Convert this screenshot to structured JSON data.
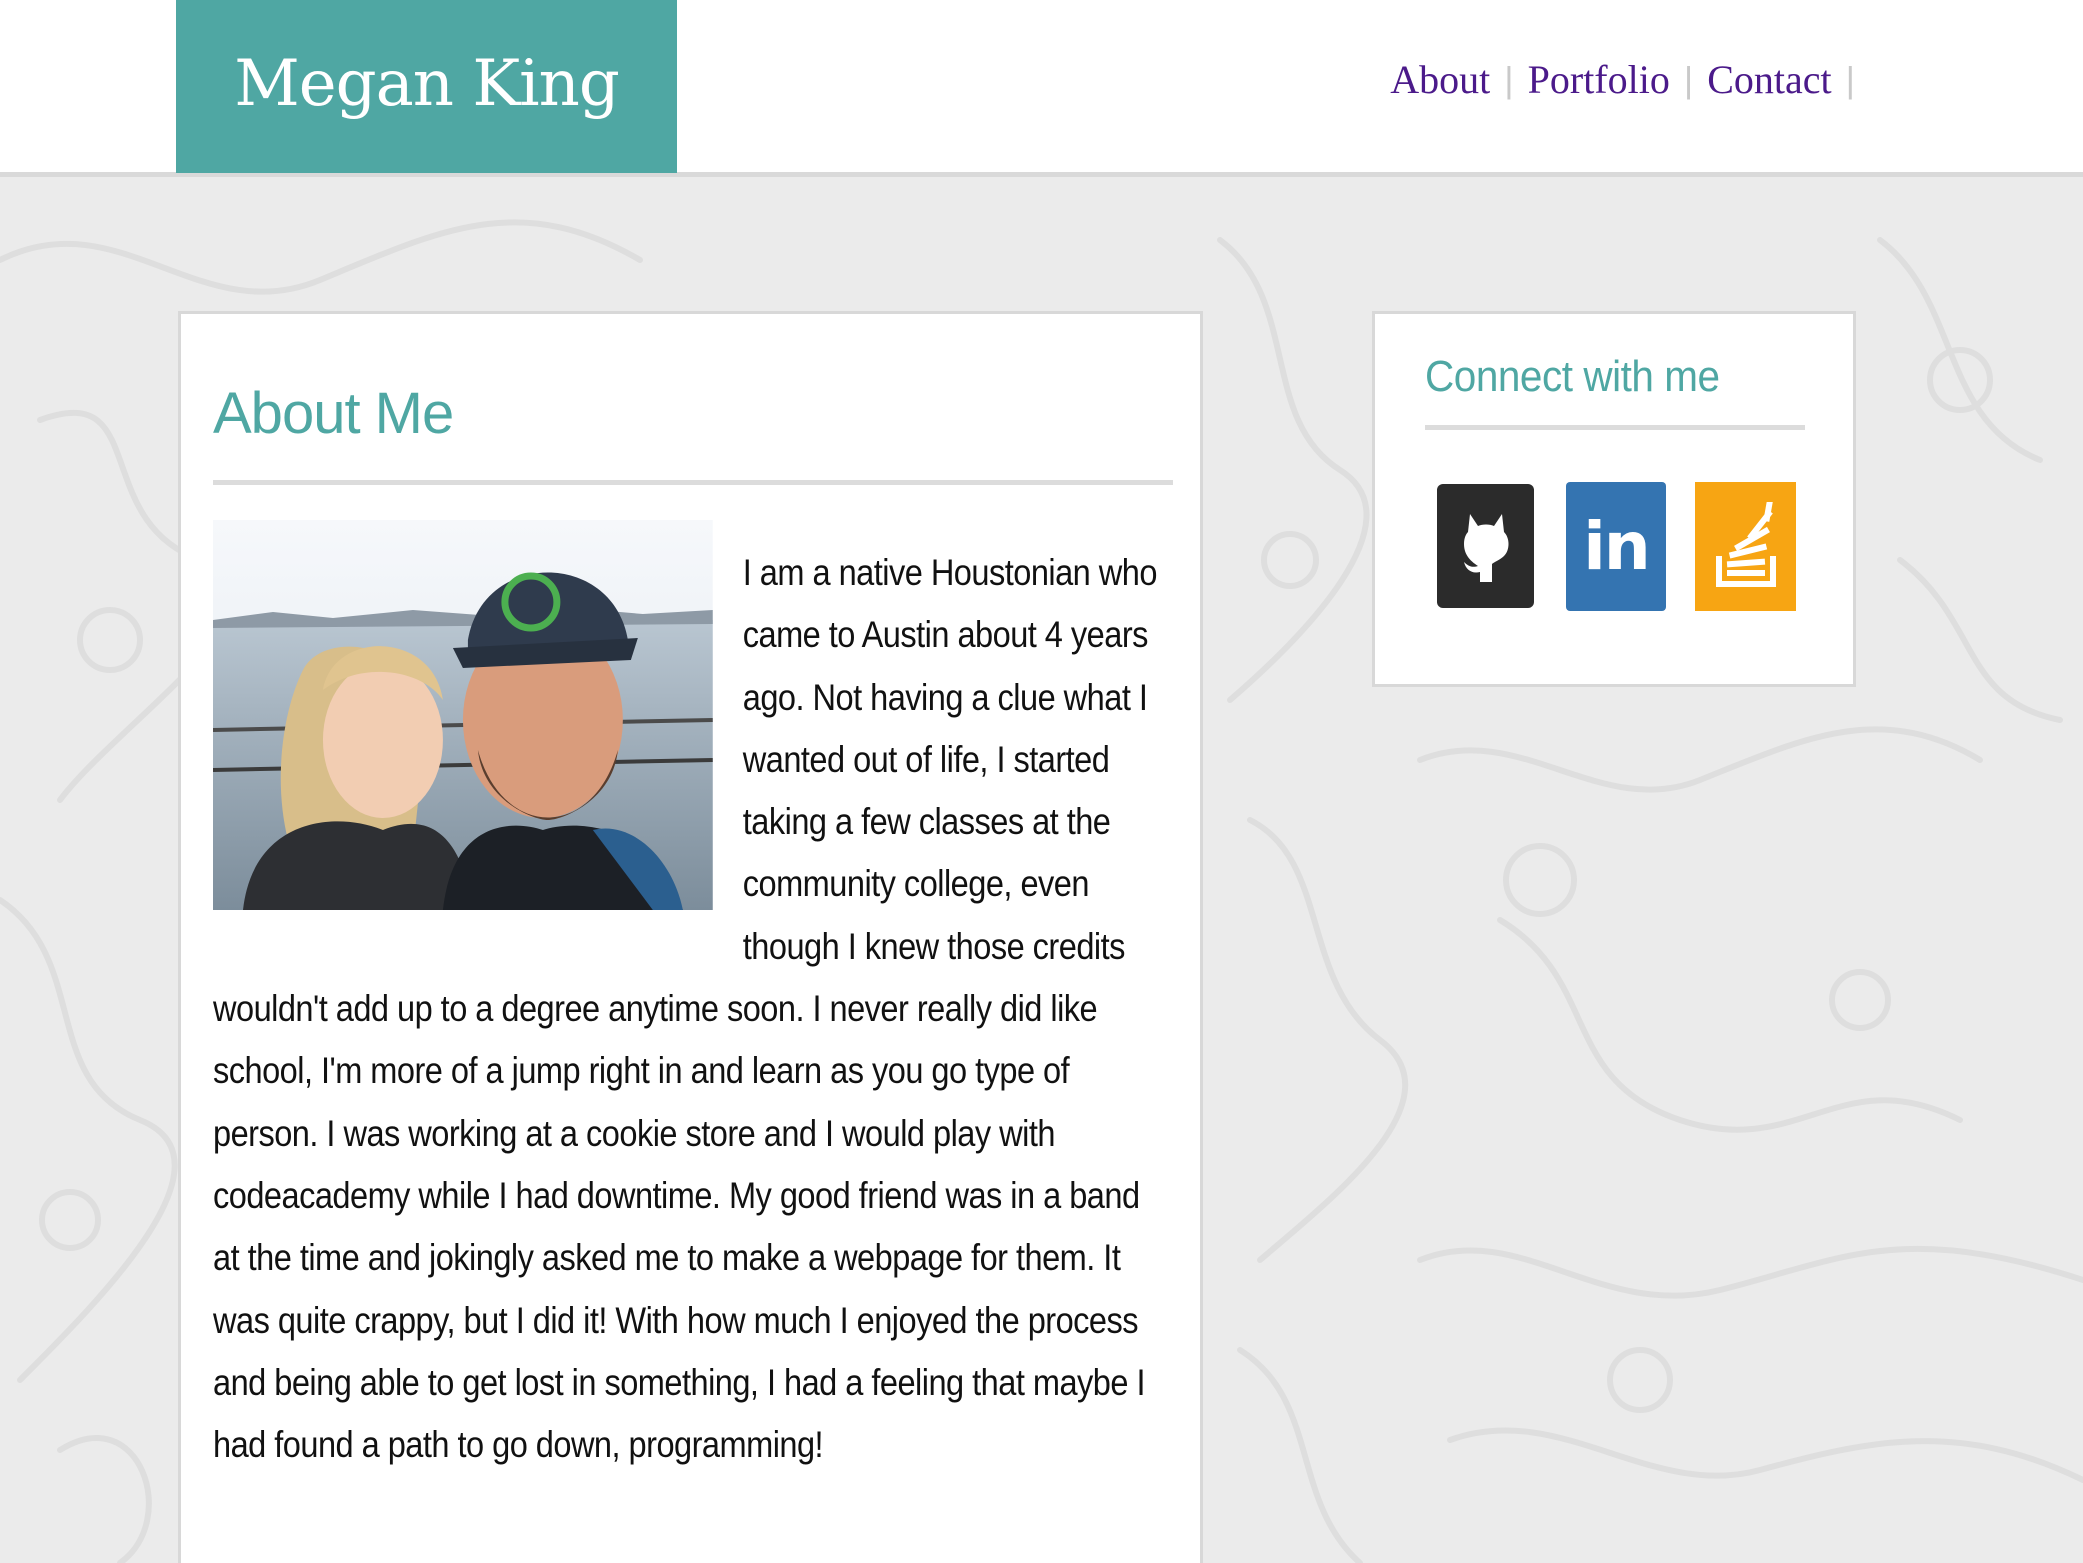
{
  "site": {
    "brand_name": "Megan King",
    "brand_color": "#4fa7a3",
    "nav": [
      {
        "label": "About"
      },
      {
        "label": "Portfolio"
      },
      {
        "label": "Contact"
      }
    ],
    "nav_color": "#4b1a8a"
  },
  "about": {
    "title": "About Me",
    "photo_icon": "couple-selfie-photo",
    "text": "I am a native Houstonian who came to Austin about 4 years ago. Not having a clue what I wanted out of life, I started taking a few classes at the community college, even though I knew those credits wouldn't add up to a degree anytime soon. I never really did like school, I'm more of a jump right in and learn as you go type of person. I was working at a cookie store and I would play with codeacademy while I had downtime. My good friend was in a band at the time and jokingly asked me to make a webpage for them. It was quite crappy, but I did it! With how much I enjoyed the process and being able to get lost in something, I had a feeling that maybe I had found a path to go down, programming!"
  },
  "connect": {
    "title": "Connect with me",
    "links": [
      {
        "icon": "github-icon",
        "color": "#2b2b2b"
      },
      {
        "icon": "linkedin-icon",
        "label": "in",
        "color": "#3474b1"
      },
      {
        "icon": "stackoverflow-icon",
        "color": "#f7a513"
      }
    ]
  }
}
